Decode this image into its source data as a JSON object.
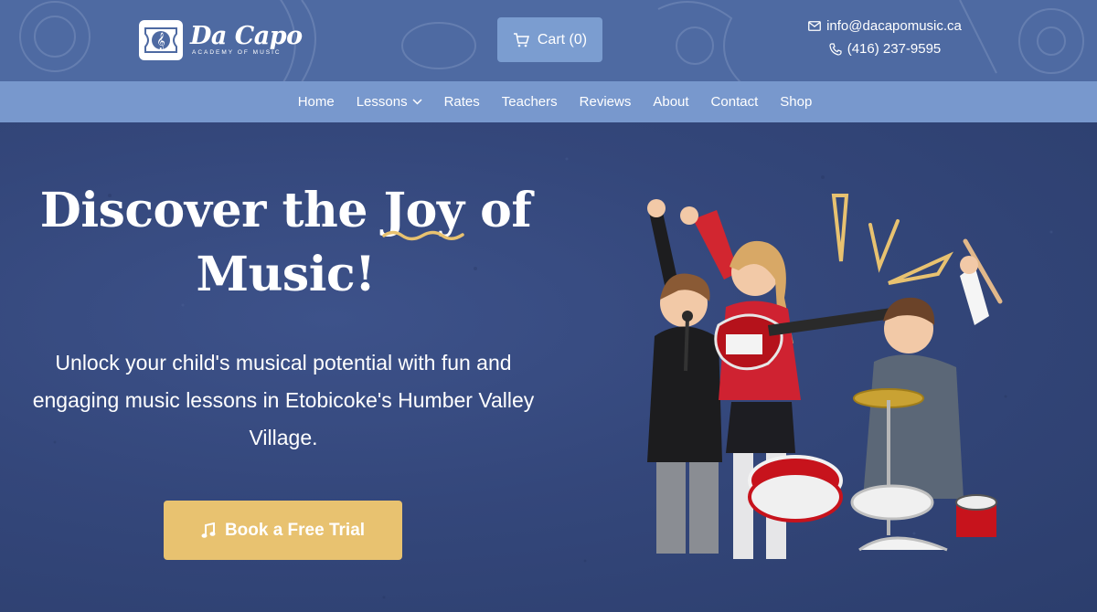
{
  "header": {
    "logo": {
      "name": "Da Capo",
      "tagline": "ACADEMY OF MUSIC",
      "icon": "treble-clef-icon"
    },
    "cart": {
      "label": "Cart (0)",
      "icon": "cart-icon"
    },
    "contact": {
      "email": "info@dacapomusic.ca",
      "email_icon": "mail-icon",
      "phone": "(416) 237-9595",
      "phone_icon": "phone-icon"
    }
  },
  "nav": {
    "items": [
      {
        "label": "Home"
      },
      {
        "label": "Lessons",
        "has_dropdown": true
      },
      {
        "label": "Rates"
      },
      {
        "label": "Teachers"
      },
      {
        "label": "Reviews"
      },
      {
        "label": "About"
      },
      {
        "label": "Contact"
      },
      {
        "label": "Shop"
      }
    ]
  },
  "hero": {
    "headline_part1": "Discover the ",
    "headline_highlight": "Joy",
    "headline_part2": " of",
    "headline_line2": "Music!",
    "subtext": "Unlock your child's musical potential with fun and engaging music lessons in Etobicoke's Humber Valley Village.",
    "cta": {
      "label": "Book a Free Trial",
      "icon": "music-note-icon"
    },
    "image": "children-playing-instruments"
  },
  "colors": {
    "header_bg": "#4e6aa2",
    "nav_bg": "#7898cd",
    "cart_bg": "#7b9dd0",
    "hero_bg": "#34477b",
    "accent_gold": "#e8c270",
    "text": "#ffffff"
  }
}
